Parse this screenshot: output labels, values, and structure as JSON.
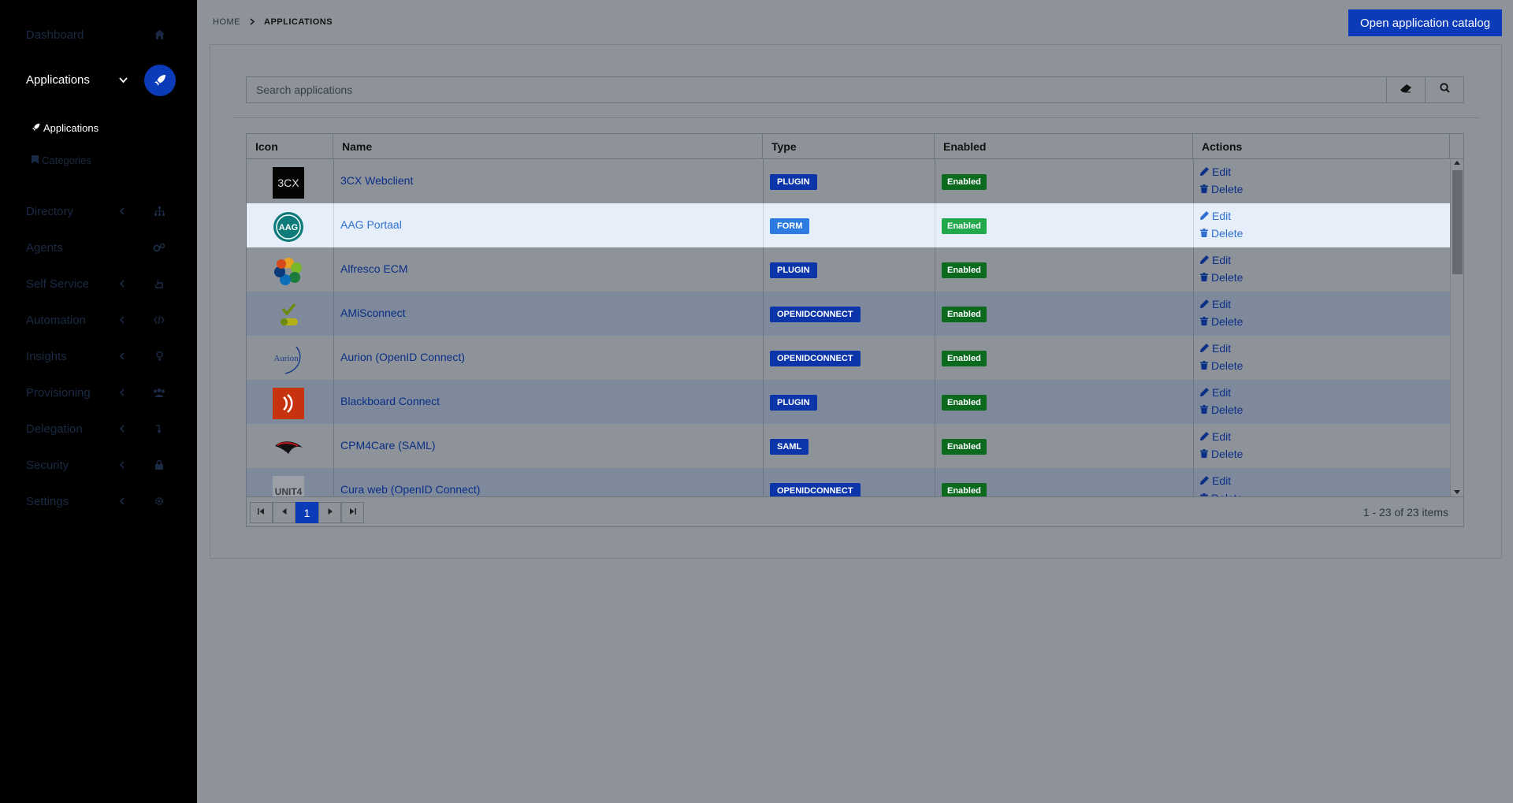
{
  "sidebar": {
    "items": [
      {
        "label": "Dashboard",
        "icon": "home-icon"
      },
      {
        "label": "Applications",
        "icon": "rocket-icon",
        "active": true
      },
      {
        "label": "Directory",
        "icon": "sitemap-icon"
      },
      {
        "label": "Agents",
        "icon": "cogs-icon"
      },
      {
        "label": "Self Service",
        "icon": "hand-pointer-icon"
      },
      {
        "label": "Automation",
        "icon": "code-icon"
      },
      {
        "label": "Insights",
        "icon": "lightbulb-icon"
      },
      {
        "label": "Provisioning",
        "icon": "users-icon"
      },
      {
        "label": "Delegation",
        "icon": "level-down-icon"
      },
      {
        "label": "Security",
        "icon": "lock-icon"
      },
      {
        "label": "Settings",
        "icon": "gear-icon"
      }
    ],
    "subitems": [
      {
        "label": "Applications",
        "icon": "rocket-icon"
      },
      {
        "label": "Categories",
        "icon": "bookmark-icon"
      }
    ]
  },
  "breadcrumb": {
    "home": "HOME",
    "current": "APPLICATIONS"
  },
  "header": {
    "catalog_button": "Open application catalog"
  },
  "search": {
    "placeholder": "Search applications"
  },
  "table": {
    "columns": [
      "Icon",
      "Name",
      "Type",
      "Enabled",
      "Actions"
    ],
    "edit_label": "Edit",
    "delete_label": "Delete",
    "rows": [
      {
        "name": "3CX Webclient",
        "type": "PLUGIN",
        "enabled": "Enabled",
        "icon": "3cx-logo"
      },
      {
        "name": "AAG Portaal",
        "type": "FORM",
        "enabled": "Enabled",
        "icon": "aag-logo"
      },
      {
        "name": "Alfresco ECM",
        "type": "PLUGIN",
        "enabled": "Enabled",
        "icon": "alfresco-logo"
      },
      {
        "name": "AMiSconnect",
        "type": "OPENIDCONNECT",
        "enabled": "Enabled",
        "icon": "amisconnect-logo"
      },
      {
        "name": "Aurion (OpenID Connect)",
        "type": "OPENIDCONNECT",
        "enabled": "Enabled",
        "icon": "aurion-logo"
      },
      {
        "name": "Blackboard Connect",
        "type": "PLUGIN",
        "enabled": "Enabled",
        "icon": "blackboard-logo"
      },
      {
        "name": "CPM4Care (SAML)",
        "type": "SAML",
        "enabled": "Enabled",
        "icon": "cpm4care-logo"
      },
      {
        "name": "Cura web (OpenID Connect)",
        "type": "OPENIDCONNECT",
        "enabled": "Enabled",
        "icon": "unit4-logo"
      }
    ]
  },
  "logo_text": {
    "cx": "3CX",
    "aag": "AAG",
    "aurion": "Aurion",
    "unit4": "UNIT4"
  },
  "pager": {
    "current_page": "1",
    "info": "1 - 23 of 23 items"
  }
}
